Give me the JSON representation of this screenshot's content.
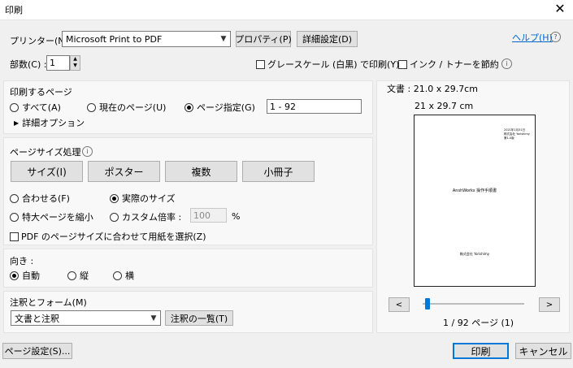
{
  "window": {
    "title": "印刷",
    "close": "✕"
  },
  "printer": {
    "label": "プリンター(N) :",
    "selected": "Microsoft Print to PDF",
    "properties_btn": "プロパティ(P)",
    "advanced_btn": "詳細設定(D)",
    "help_link": "ヘルプ(H)",
    "help_icon": "?"
  },
  "copies": {
    "label": "部数(C) :",
    "value": "1"
  },
  "options": {
    "grayscale": "グレースケール (白黒) で印刷(Y)",
    "save_ink": "インク / トナーを節約"
  },
  "print_range": {
    "heading": "印刷するページ",
    "all": "すべて(A)",
    "current": "現在のページ(U)",
    "pages": "ページ指定(G)",
    "pages_value": "1 - 92",
    "more_options": "詳細オプション"
  },
  "page_sizing": {
    "heading": "ページサイズ処理",
    "buttons": [
      "サイズ(I)",
      "ポスター",
      "複数",
      "小冊子"
    ],
    "fit": "合わせる(F)",
    "actual": "実際のサイズ",
    "shrink": "特大ページを縮小",
    "custom": "カスタム倍率 :",
    "custom_value": "100",
    "percent": "%",
    "choose_paper": "PDF のページサイズに合わせて用紙を選択(Z)"
  },
  "orientation": {
    "heading": "向き :",
    "auto": "自動",
    "portrait": "縦",
    "landscape": "横"
  },
  "comments": {
    "heading": "注釈とフォーム(M)",
    "selected": "文書と注釈",
    "summarize_btn": "注釈の一覧(T)"
  },
  "preview": {
    "doc_size": "文書 : 21.0 x 29.7cm",
    "page_size": "21 x 29.7 cm",
    "prev": "<",
    "next": ">",
    "page_status": "1 / 92 ページ (1)",
    "slider_position": 0.02,
    "mini_header_lines": [
      "2021年1月31日",
      "株式会社 Yorishimy",
      "第1.0版"
    ],
    "mini_title": "AnshWorks 操作手順書",
    "mini_footer": "株式会社 Yorishimy"
  },
  "footer": {
    "page_setup": "ページ設定(S)...",
    "print": "印刷",
    "cancel": "キャンセル"
  }
}
